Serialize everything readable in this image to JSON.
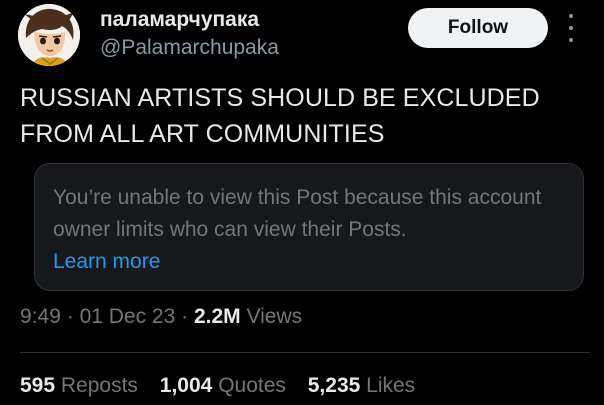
{
  "author": {
    "display_name": "паламарчупака",
    "handle": "@Palamarchupaka"
  },
  "header": {
    "follow_label": "Follow"
  },
  "post": {
    "text": "RUSSIAN ARTISTS SHOULD BE EXCLUDED FROM ALL ART COMMUNITIES",
    "quote_unavailable": {
      "message": "You’re unable to view this Post because this account owner limits who can view their Posts.",
      "link_label": "Learn more"
    },
    "time": "9:49",
    "separator": "·",
    "date": "01 Dec 23",
    "views_count": "2.2M",
    "views_label": "Views"
  },
  "stats": [
    {
      "count": "595",
      "label": "Reposts"
    },
    {
      "count": "1,004",
      "label": "Quotes"
    },
    {
      "count": "5,235",
      "label": "Likes"
    }
  ],
  "icons": {
    "more": "more-vertical-icon"
  },
  "colors": {
    "background": "#000000",
    "primary_text": "#e7e9ea",
    "secondary_text": "#71767b",
    "link": "#1d9bf0",
    "follow_bg": "#eff3f4",
    "follow_text": "#0f1419",
    "card_bg": "#16181c",
    "border": "#2f3336"
  }
}
